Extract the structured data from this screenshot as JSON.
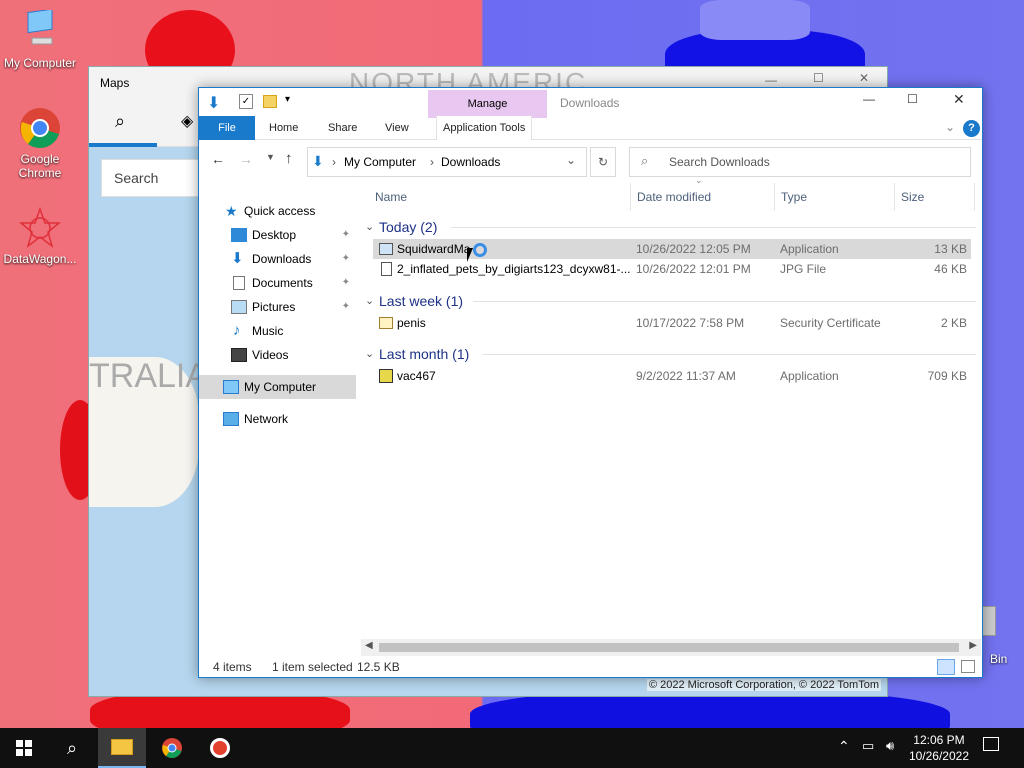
{
  "desktop": {
    "icons": [
      {
        "label": "My Computer"
      },
      {
        "label": "Google Chrome"
      },
      {
        "label": "DataWagon..."
      },
      {
        "label": "Bin"
      }
    ]
  },
  "maps": {
    "title": "Maps",
    "search_placeholder": "Search",
    "map_labels": {
      "north": "NORTH AMERIC",
      "australia": "TRALIA"
    },
    "copyright": "© 2022 Microsoft Corporation, © 2022 TomTom"
  },
  "explorer": {
    "window_title": "Downloads",
    "ribbon": {
      "manage": "Manage",
      "tabs": [
        "File",
        "Home",
        "Share",
        "View",
        "Application Tools"
      ]
    },
    "address": {
      "root": "My Computer",
      "folder": "Downloads"
    },
    "search_placeholder": "Search Downloads",
    "nav": {
      "quick_access": "Quick access",
      "items": [
        "Desktop",
        "Downloads",
        "Documents",
        "Pictures",
        "Music",
        "Videos"
      ],
      "my_computer": "My Computer",
      "network": "Network"
    },
    "columns": [
      "Name",
      "Date modified",
      "Type",
      "Size"
    ],
    "groups": [
      {
        "label": "Today (2)",
        "files": [
          {
            "name": "SquidwardMa",
            "date": "10/26/2022 12:05 PM",
            "type": "Application",
            "size": "13 KB",
            "selected": true
          },
          {
            "name": "2_inflated_pets_by_digiarts123_dcyxw81-...",
            "date": "10/26/2022 12:01 PM",
            "type": "JPG File",
            "size": "46 KB"
          }
        ]
      },
      {
        "label": "Last week (1)",
        "files": [
          {
            "name": "penis",
            "date": "10/17/2022 7:58 PM",
            "type": "Security Certificate",
            "size": "2 KB"
          }
        ]
      },
      {
        "label": "Last month (1)",
        "files": [
          {
            "name": "vac467",
            "date": "9/2/2022 11:37 AM",
            "type": "Application",
            "size": "709 KB"
          }
        ]
      }
    ],
    "status": {
      "items": "4 items",
      "selected": "1 item selected",
      "size": "12.5 KB"
    }
  },
  "taskbar": {
    "time": "12:06 PM",
    "date": "10/26/2022"
  },
  "colors": {
    "accent": "#1979ca",
    "group_header": "#1e3287",
    "manage_tab": "#e8c8f0"
  }
}
